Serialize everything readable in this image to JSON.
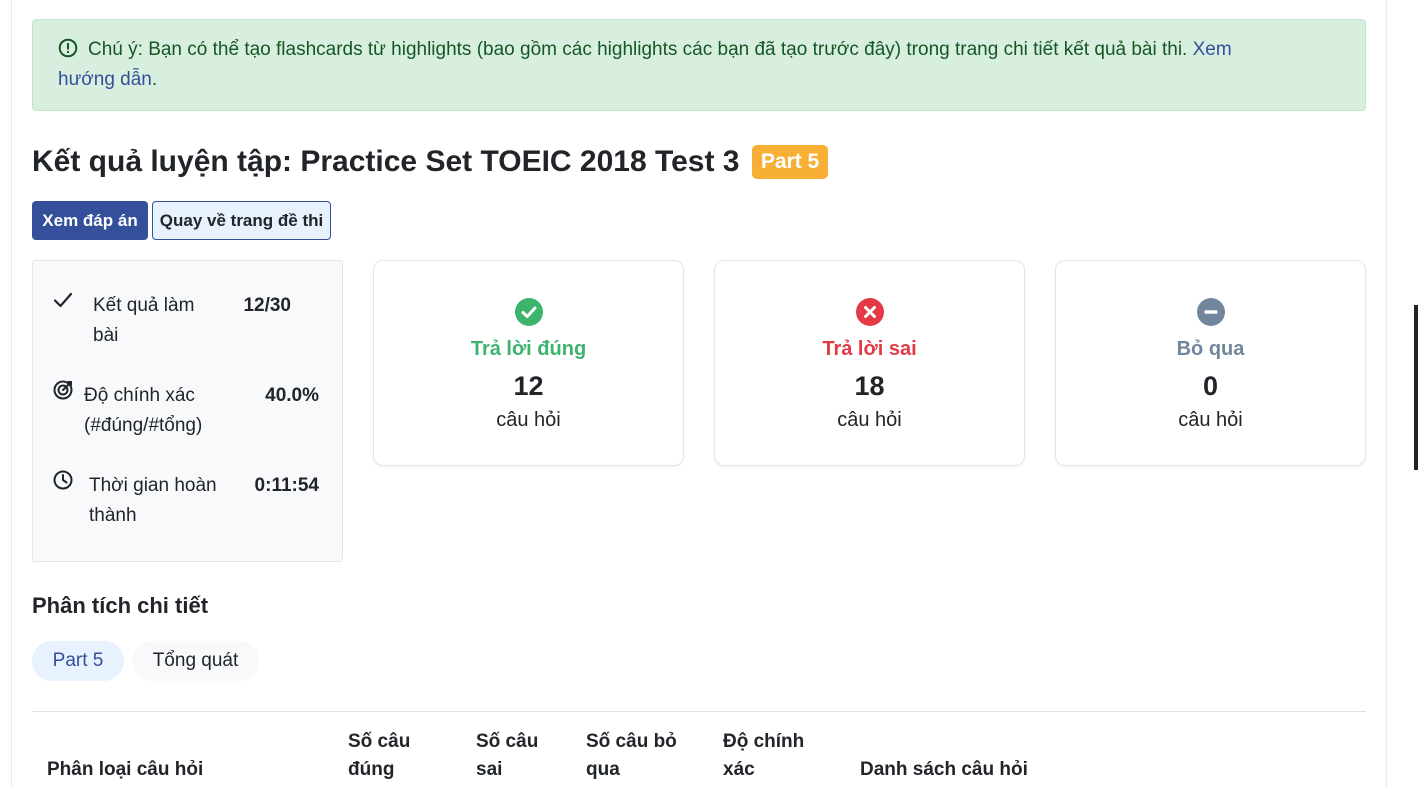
{
  "alert": {
    "text": "Chú ý: Bạn có thể tạo flashcards từ highlights (bao gồm các highlights các bạn đã tạo trước đây) trong trang chi tiết kết quả bài thi.",
    "link_line1": "Xem",
    "link_line2": "hướng dẫn",
    "suffix": "."
  },
  "header": {
    "title": "Kết quả luyện tập: Practice Set TOEIC 2018 Test 3",
    "badge": "Part 5"
  },
  "actions": {
    "view_answers": "Xem đáp án",
    "back_to_test": "Quay về trang đề thi"
  },
  "summary": {
    "result_label_1": "Kết quả làm",
    "result_label_2": "bài",
    "result_value": "12/30",
    "accuracy_label_1": "Độ chính xác",
    "accuracy_label_2": "(#đúng/#tổng)",
    "accuracy_value": "40.0%",
    "time_label_1": "Thời gian hoàn",
    "time_label_2": "thành",
    "time_value": "0:11:54"
  },
  "results": {
    "correct": {
      "label": "Trả lời đúng",
      "count": "12",
      "unit": "câu hỏi"
    },
    "wrong": {
      "label": "Trả lời sai",
      "count": "18",
      "unit": "câu hỏi"
    },
    "skipped": {
      "label": "Bỏ qua",
      "count": "0",
      "unit": "câu hỏi"
    }
  },
  "analysis": {
    "title": "Phân tích chi tiết",
    "tabs": [
      "Part 5",
      "Tổng quát"
    ]
  },
  "table": {
    "headers": {
      "category": "Phân loại câu hỏi",
      "correct_1": "Số câu",
      "correct_2": "đúng",
      "wrong_1": "Số câu",
      "wrong_2": "sai",
      "skipped_1": "Số câu bỏ",
      "skipped_2": "qua",
      "accuracy_1": "Độ chính",
      "accuracy_2": "xác",
      "questions": "Danh sách câu hỏi"
    }
  },
  "colors": {
    "primary": "#35509a",
    "correct": "#3cb46e",
    "wrong": "#e43a45",
    "skipped": "#71869d",
    "badge": "#f7b035",
    "alert_bg": "#d8efe0"
  }
}
